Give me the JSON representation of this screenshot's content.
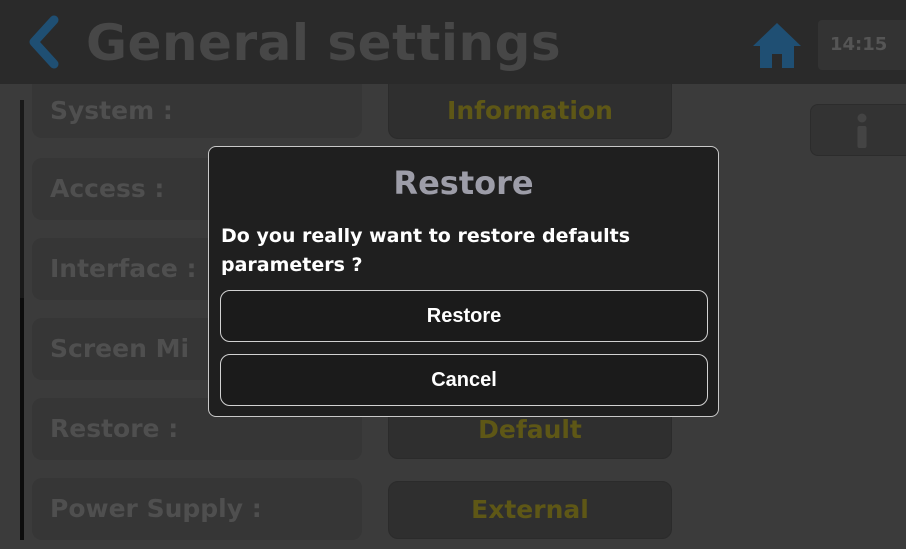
{
  "header": {
    "title": "General settings",
    "clock": "14:15",
    "back_icon": "chevron-left-icon",
    "home_icon": "home-icon",
    "accent_color": "#1f5f8f"
  },
  "settings": {
    "rows": [
      {
        "label": "System :",
        "value": "Information"
      },
      {
        "label": "Access :",
        "value": ""
      },
      {
        "label": "Interface :",
        "value": ""
      },
      {
        "label": "Screen Mi",
        "value": ""
      },
      {
        "label": "Restore :",
        "value": "Default"
      },
      {
        "label": "Power Supply :",
        "value": "External"
      }
    ],
    "info_icon": "info-icon"
  },
  "dialog": {
    "title": "Restore",
    "message": "Do you really want to restore defaults parameters ?",
    "confirm_label": "Restore",
    "cancel_label": "Cancel"
  }
}
